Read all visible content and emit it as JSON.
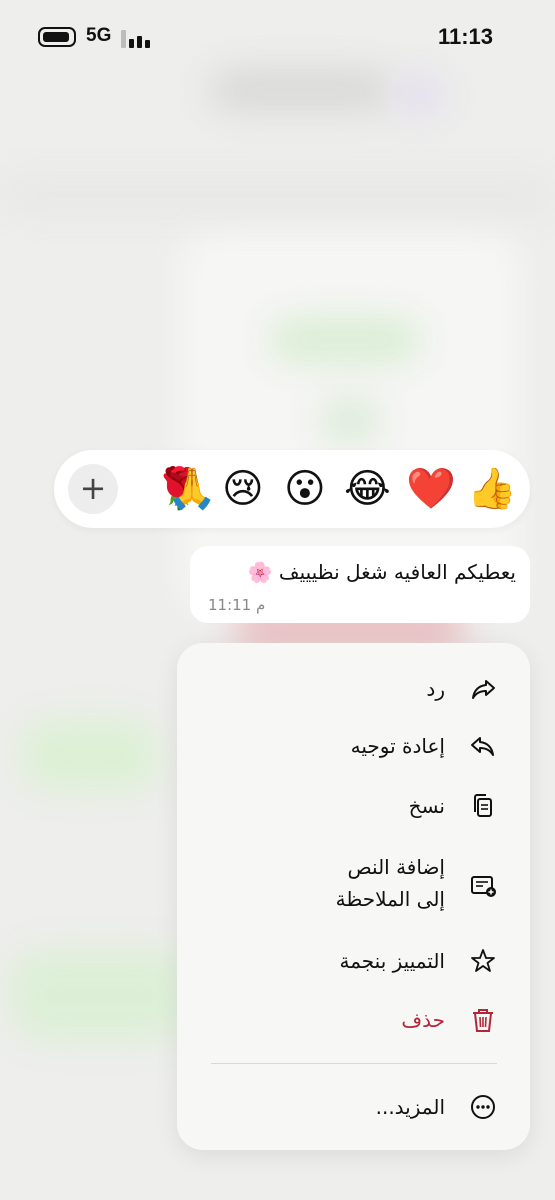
{
  "status_bar": {
    "network": "5G",
    "time": "11:13"
  },
  "reactions": {
    "emojis": [
      "👍",
      "❤️",
      "😂",
      "😮",
      "😢",
      "🙏",
      "🌹"
    ],
    "add_label": "+"
  },
  "message": {
    "text": "يعطيكم العافيه شغل نظيييف 🌸",
    "time": "11:11 م"
  },
  "menu": {
    "items": [
      {
        "label": "رد",
        "icon": "reply-icon"
      },
      {
        "label": "إعادة توجيه",
        "icon": "forward-icon"
      },
      {
        "label": "نسخ",
        "icon": "copy-icon"
      },
      {
        "label": "إضافة النص",
        "label_line2": "إلى الملاحظة",
        "icon": "note-add-icon"
      },
      {
        "label": "التمييز بنجمة",
        "icon": "star-icon"
      },
      {
        "label": "حذف",
        "icon": "trash-icon",
        "color": "#b3263a"
      },
      {
        "label": "المزيد...",
        "icon": "more-icon"
      }
    ]
  }
}
